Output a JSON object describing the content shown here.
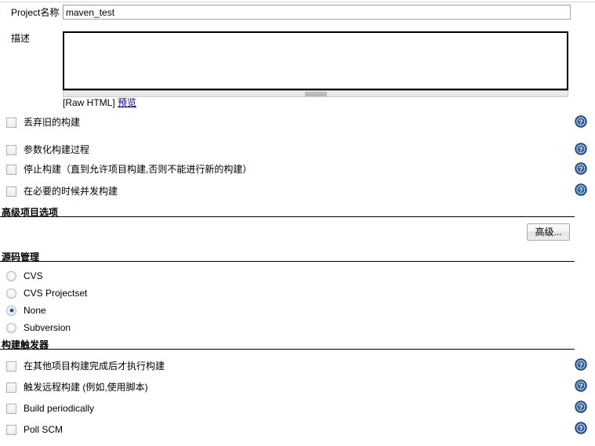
{
  "form": {
    "project_name": {
      "label": "Project名称",
      "value": "maven_test",
      "placeholder": ""
    },
    "description": {
      "label": "描述",
      "value": "",
      "placeholder": "",
      "raw_html_text": "[Raw HTML]",
      "preview_link": "预览"
    }
  },
  "general_options": {
    "checkboxes": [
      {
        "label": "丢弃旧的构建",
        "checked": false,
        "help": "help-icon"
      },
      {
        "label": "参数化构建过程",
        "checked": false,
        "help": "help-icon"
      },
      {
        "label": "停止构建（直到允许项目构建,否则不能进行新的构建）",
        "checked": false,
        "help": "help-icon"
      },
      {
        "label": "在必要的时候并发构建",
        "checked": false,
        "help": "help-icon"
      }
    ]
  },
  "advanced_section": {
    "heading": "高级项目选项",
    "button_label": "高级..."
  },
  "scm_section": {
    "heading": "源码管理",
    "radios": [
      {
        "label": "CVS",
        "checked": false
      },
      {
        "label": "CVS Projectset",
        "checked": false
      },
      {
        "label": "None",
        "checked": true
      },
      {
        "label": "Subversion",
        "checked": false
      }
    ]
  },
  "triggers_section": {
    "heading": "构建触发器",
    "checkboxes": [
      {
        "label": "在其他项目构建完成后才执行构建",
        "checked": false,
        "help": "help-icon"
      },
      {
        "label": "触发远程构建 (例如,使用脚本)",
        "checked": false,
        "help": "help-icon"
      },
      {
        "label": "Build periodically",
        "checked": false,
        "help": "help-icon"
      },
      {
        "label": "Poll SCM",
        "checked": false,
        "help": "help-icon"
      }
    ]
  },
  "colors": {
    "help_icon_blue": "#2f5d99",
    "link_blue": "#000080",
    "radio_selected": "#1c5a86"
  }
}
